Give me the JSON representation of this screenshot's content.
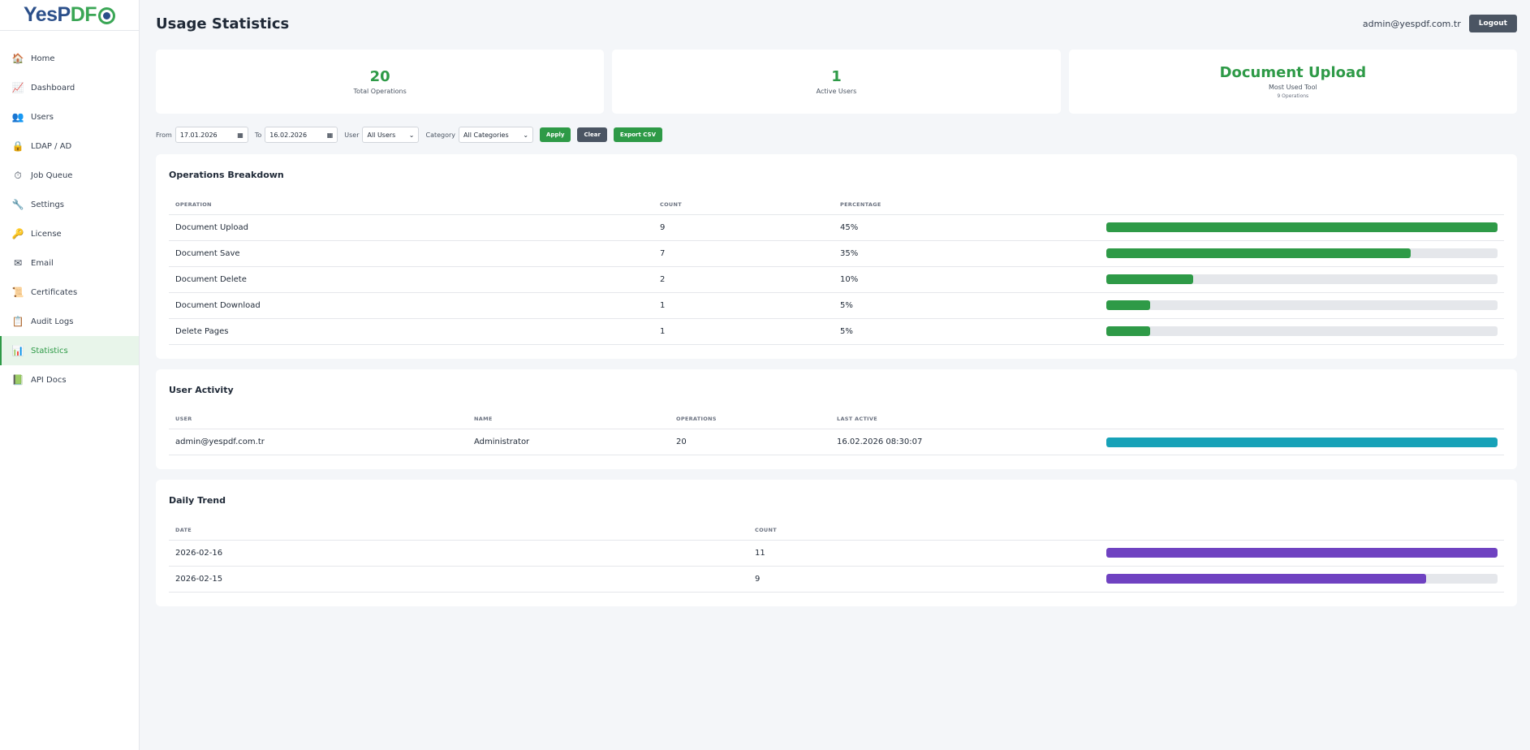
{
  "brand": {
    "yes": "YesP",
    "pdf": "DF"
  },
  "nav": [
    {
      "label": "Home",
      "icon": "home-icon",
      "glyph": "🏠"
    },
    {
      "label": "Dashboard",
      "icon": "chart-icon",
      "glyph": "📈"
    },
    {
      "label": "Users",
      "icon": "users-icon",
      "glyph": "👥"
    },
    {
      "label": "LDAP / AD",
      "icon": "lock-icon",
      "glyph": "🔒"
    },
    {
      "label": "Job Queue",
      "icon": "stopwatch-icon",
      "glyph": "⏱"
    },
    {
      "label": "Settings",
      "icon": "wrench-icon",
      "glyph": "🔧"
    },
    {
      "label": "License",
      "icon": "key-icon",
      "glyph": "🔑"
    },
    {
      "label": "Email",
      "icon": "envelope-icon",
      "glyph": "✉"
    },
    {
      "label": "Certificates",
      "icon": "certificate-icon",
      "glyph": "📜"
    },
    {
      "label": "Audit Logs",
      "icon": "clipboard-icon",
      "glyph": "📋"
    },
    {
      "label": "Statistics",
      "icon": "bar-chart-icon",
      "glyph": "📊",
      "active": true
    },
    {
      "label": "API Docs",
      "icon": "book-icon",
      "glyph": "📗"
    }
  ],
  "header": {
    "title": "Usage Statistics",
    "user_email": "admin@yespdf.com.tr",
    "logout_label": "Logout"
  },
  "cards": [
    {
      "value": "20",
      "label": "Total Operations"
    },
    {
      "value": "1",
      "label": "Active Users"
    },
    {
      "value": "Document Upload",
      "label": "Most Used Tool",
      "sub": "9 Operations"
    }
  ],
  "filters": {
    "from_label": "From",
    "from_value": "17.01.2026",
    "to_label": "To",
    "to_value": "16.02.2026",
    "user_label": "User",
    "user_value": "All Users",
    "category_label": "Category",
    "category_value": "All Categories",
    "apply_label": "Apply",
    "clear_label": "Clear",
    "export_label": "Export CSV"
  },
  "operations": {
    "title": "Operations Breakdown",
    "headers": [
      "Operation",
      "Count",
      "Percentage"
    ],
    "rows": [
      {
        "name": "Document Upload",
        "count": "9",
        "percent": "45%",
        "fill": 1.0
      },
      {
        "name": "Document Save",
        "count": "7",
        "percent": "35%",
        "fill": 0.778
      },
      {
        "name": "Document Delete",
        "count": "2",
        "percent": "10%",
        "fill": 0.222
      },
      {
        "name": "Document Download",
        "count": "1",
        "percent": "5%",
        "fill": 0.111
      },
      {
        "name": "Delete Pages",
        "count": "1",
        "percent": "5%",
        "fill": 0.111
      }
    ]
  },
  "user_activity": {
    "title": "User Activity",
    "headers": [
      "User",
      "Name",
      "Operations",
      "Last Active"
    ],
    "rows": [
      {
        "user": "admin@yespdf.com.tr",
        "name": "Administrator",
        "operations": "20",
        "last_active": "16.02.2026 08:30:07",
        "fill": 1.0
      }
    ]
  },
  "daily_trend": {
    "title": "Daily Trend",
    "headers": [
      "Date",
      "Count"
    ],
    "rows": [
      {
        "date": "2026-02-16",
        "count": "11",
        "fill": 1.0
      },
      {
        "date": "2026-02-15",
        "count": "9",
        "fill": 0.818
      }
    ]
  }
}
